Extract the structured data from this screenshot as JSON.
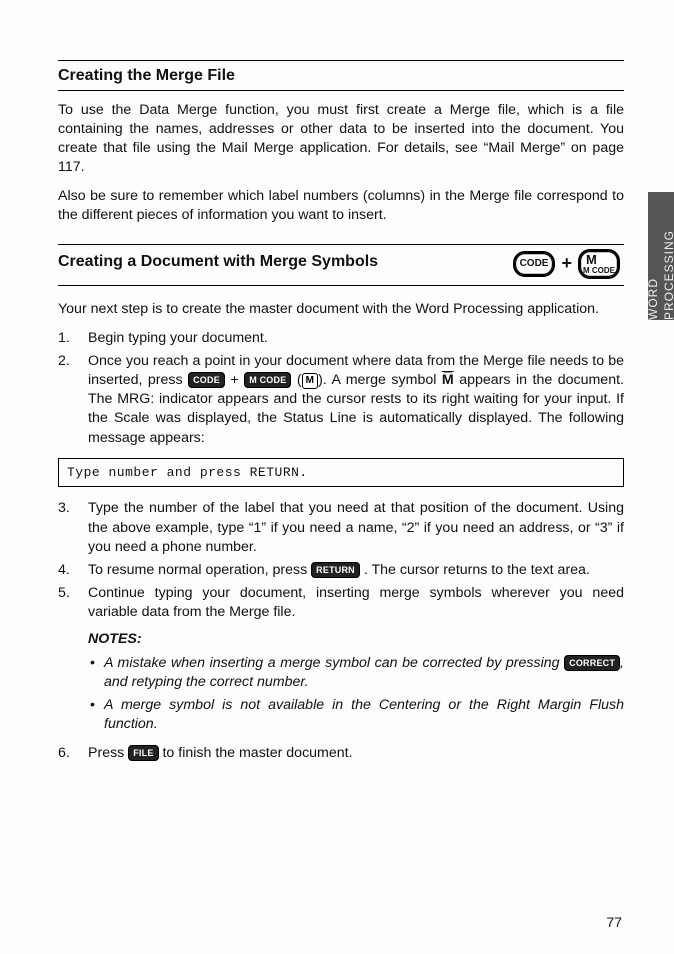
{
  "sideTab": "WORD PROCESSING",
  "pageNumber": "77",
  "section1": {
    "title": "Creating the Merge File",
    "p1": "To use the Data Merge function, you must first create a Merge file, which is a file containing the names, addresses or other data to be inserted into the document. You create that file using the Mail Merge application. For details, see “Mail Merge” on page 117.",
    "p2": "Also be sure to remember which label numbers (columns) in the Merge file correspond to the different pieces of information you want to insert."
  },
  "section2": {
    "title": "Creating a Document with Merge Symbols",
    "key1_line1": "CODE",
    "plus": "+",
    "key2_line1": "M",
    "key2_line2": "M CODE",
    "intro": "Your next step is to create the master document with the Word Processing application.",
    "li1": "Begin typing your document.",
    "li2_a": "Once you reach a point in your document where data from the Merge file needs to be inserted, press ",
    "li2_key1": "CODE",
    "li2_plus": " + ",
    "li2_key2": "M CODE",
    "li2_b": " (",
    "li2_key3": "M",
    "li2_c": "). A merge symbol  ",
    "li2_sym": "M̅",
    "li2_d": "  appears in the document. The MRG: indicator appears and the cursor rests to its right waiting for your input. If the Scale was displayed, the Status Line is automatically displayed. The following message appears:",
    "msg": "Type number and press RETURN.",
    "li3": "Type the number of the label that you need at that position of the document. Using the above example, type “1” if you need a name, “2” if you need an address, or “3” if you need a phone number.",
    "li4_a": "To resume normal operation, press ",
    "li4_key": "RETURN",
    "li4_b": ". The cursor returns to the text area.",
    "li5": "Continue typing your document, inserting merge symbols wherever you need variable data from the Merge file.",
    "notesLabel": "NOTES:",
    "note1_a": "A mistake when inserting a merge symbol can be corrected by pressing ",
    "note1_key": "CORRECT",
    "note1_b": ", and retyping the correct number.",
    "note2": "A merge symbol is not available in the Centering or the Right Margin Flush function.",
    "li6_a": "Press ",
    "li6_key": "FILE",
    "li6_b": " to finish the master document."
  }
}
